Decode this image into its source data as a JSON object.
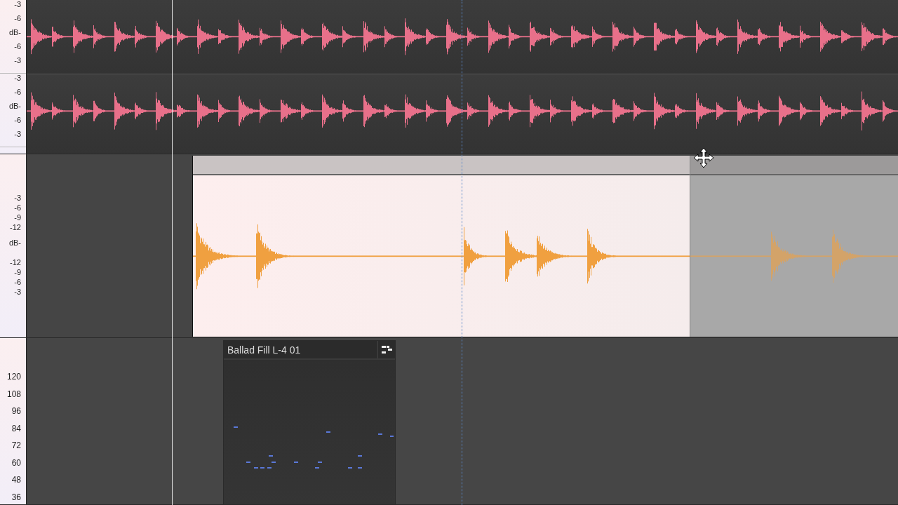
{
  "lanes": [
    {
      "kind": "audio",
      "color": "#e8708a",
      "channels": [
        {
          "scale": [
            "-3",
            "-6",
            "dB-",
            "-6",
            "-3"
          ]
        },
        {
          "scale": [
            "-3",
            "-6",
            "dB-",
            "-6",
            "-3"
          ]
        }
      ]
    },
    {
      "kind": "audio-clip",
      "color": "#f0a040",
      "scale": [
        "-3",
        "-6",
        "-9",
        "-12",
        "dB-",
        "-12",
        "-9",
        "-6",
        "-3"
      ],
      "segments": [
        {
          "selected": true
        },
        {
          "selected": false
        }
      ]
    },
    {
      "kind": "midi",
      "scale": [
        "120",
        "108",
        "96",
        "84",
        "72",
        "60",
        "48",
        "36"
      ],
      "clip": {
        "title": "Ballad Fill L-4 01"
      }
    }
  ]
}
